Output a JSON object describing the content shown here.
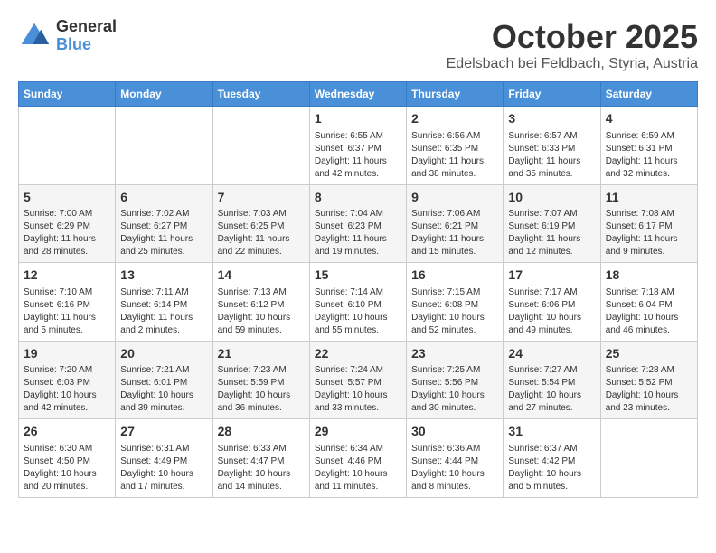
{
  "header": {
    "logo_general": "General",
    "logo_blue": "Blue",
    "month_title": "October 2025",
    "subtitle": "Edelsbach bei Feldbach, Styria, Austria"
  },
  "weekdays": [
    "Sunday",
    "Monday",
    "Tuesday",
    "Wednesday",
    "Thursday",
    "Friday",
    "Saturday"
  ],
  "weeks": [
    [
      {
        "day": "",
        "content": ""
      },
      {
        "day": "",
        "content": ""
      },
      {
        "day": "",
        "content": ""
      },
      {
        "day": "1",
        "content": "Sunrise: 6:55 AM\nSunset: 6:37 PM\nDaylight: 11 hours\nand 42 minutes."
      },
      {
        "day": "2",
        "content": "Sunrise: 6:56 AM\nSunset: 6:35 PM\nDaylight: 11 hours\nand 38 minutes."
      },
      {
        "day": "3",
        "content": "Sunrise: 6:57 AM\nSunset: 6:33 PM\nDaylight: 11 hours\nand 35 minutes."
      },
      {
        "day": "4",
        "content": "Sunrise: 6:59 AM\nSunset: 6:31 PM\nDaylight: 11 hours\nand 32 minutes."
      }
    ],
    [
      {
        "day": "5",
        "content": "Sunrise: 7:00 AM\nSunset: 6:29 PM\nDaylight: 11 hours\nand 28 minutes."
      },
      {
        "day": "6",
        "content": "Sunrise: 7:02 AM\nSunset: 6:27 PM\nDaylight: 11 hours\nand 25 minutes."
      },
      {
        "day": "7",
        "content": "Sunrise: 7:03 AM\nSunset: 6:25 PM\nDaylight: 11 hours\nand 22 minutes."
      },
      {
        "day": "8",
        "content": "Sunrise: 7:04 AM\nSunset: 6:23 PM\nDaylight: 11 hours\nand 19 minutes."
      },
      {
        "day": "9",
        "content": "Sunrise: 7:06 AM\nSunset: 6:21 PM\nDaylight: 11 hours\nand 15 minutes."
      },
      {
        "day": "10",
        "content": "Sunrise: 7:07 AM\nSunset: 6:19 PM\nDaylight: 11 hours\nand 12 minutes."
      },
      {
        "day": "11",
        "content": "Sunrise: 7:08 AM\nSunset: 6:17 PM\nDaylight: 11 hours\nand 9 minutes."
      }
    ],
    [
      {
        "day": "12",
        "content": "Sunrise: 7:10 AM\nSunset: 6:16 PM\nDaylight: 11 hours\nand 5 minutes."
      },
      {
        "day": "13",
        "content": "Sunrise: 7:11 AM\nSunset: 6:14 PM\nDaylight: 11 hours\nand 2 minutes."
      },
      {
        "day": "14",
        "content": "Sunrise: 7:13 AM\nSunset: 6:12 PM\nDaylight: 10 hours\nand 59 minutes."
      },
      {
        "day": "15",
        "content": "Sunrise: 7:14 AM\nSunset: 6:10 PM\nDaylight: 10 hours\nand 55 minutes."
      },
      {
        "day": "16",
        "content": "Sunrise: 7:15 AM\nSunset: 6:08 PM\nDaylight: 10 hours\nand 52 minutes."
      },
      {
        "day": "17",
        "content": "Sunrise: 7:17 AM\nSunset: 6:06 PM\nDaylight: 10 hours\nand 49 minutes."
      },
      {
        "day": "18",
        "content": "Sunrise: 7:18 AM\nSunset: 6:04 PM\nDaylight: 10 hours\nand 46 minutes."
      }
    ],
    [
      {
        "day": "19",
        "content": "Sunrise: 7:20 AM\nSunset: 6:03 PM\nDaylight: 10 hours\nand 42 minutes."
      },
      {
        "day": "20",
        "content": "Sunrise: 7:21 AM\nSunset: 6:01 PM\nDaylight: 10 hours\nand 39 minutes."
      },
      {
        "day": "21",
        "content": "Sunrise: 7:23 AM\nSunset: 5:59 PM\nDaylight: 10 hours\nand 36 minutes."
      },
      {
        "day": "22",
        "content": "Sunrise: 7:24 AM\nSunset: 5:57 PM\nDaylight: 10 hours\nand 33 minutes."
      },
      {
        "day": "23",
        "content": "Sunrise: 7:25 AM\nSunset: 5:56 PM\nDaylight: 10 hours\nand 30 minutes."
      },
      {
        "day": "24",
        "content": "Sunrise: 7:27 AM\nSunset: 5:54 PM\nDaylight: 10 hours\nand 27 minutes."
      },
      {
        "day": "25",
        "content": "Sunrise: 7:28 AM\nSunset: 5:52 PM\nDaylight: 10 hours\nand 23 minutes."
      }
    ],
    [
      {
        "day": "26",
        "content": "Sunrise: 6:30 AM\nSunset: 4:50 PM\nDaylight: 10 hours\nand 20 minutes."
      },
      {
        "day": "27",
        "content": "Sunrise: 6:31 AM\nSunset: 4:49 PM\nDaylight: 10 hours\nand 17 minutes."
      },
      {
        "day": "28",
        "content": "Sunrise: 6:33 AM\nSunset: 4:47 PM\nDaylight: 10 hours\nand 14 minutes."
      },
      {
        "day": "29",
        "content": "Sunrise: 6:34 AM\nSunset: 4:46 PM\nDaylight: 10 hours\nand 11 minutes."
      },
      {
        "day": "30",
        "content": "Sunrise: 6:36 AM\nSunset: 4:44 PM\nDaylight: 10 hours\nand 8 minutes."
      },
      {
        "day": "31",
        "content": "Sunrise: 6:37 AM\nSunset: 4:42 PM\nDaylight: 10 hours\nand 5 minutes."
      },
      {
        "day": "",
        "content": ""
      }
    ]
  ]
}
